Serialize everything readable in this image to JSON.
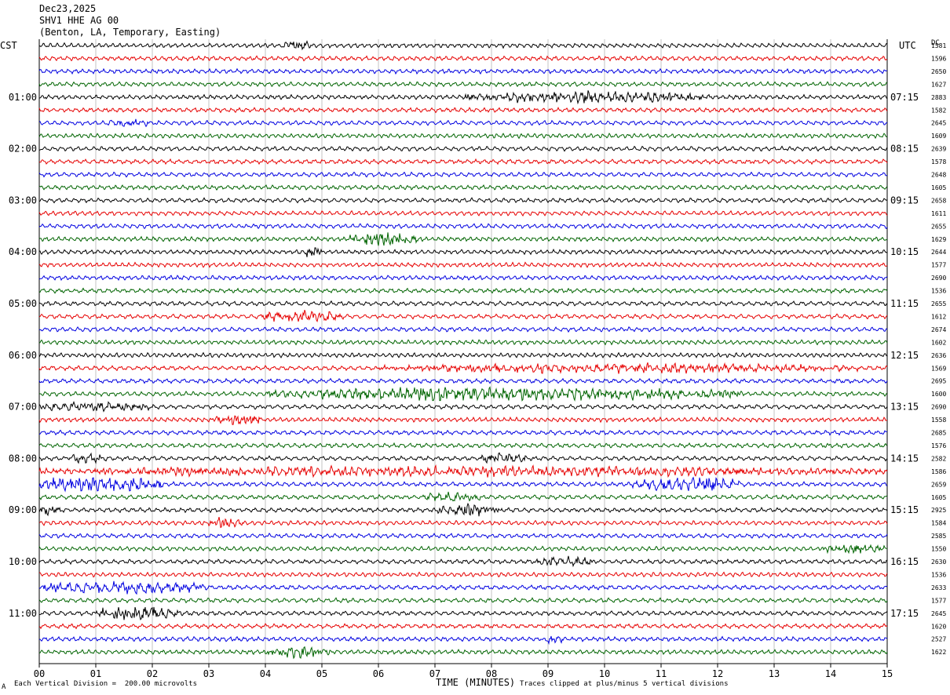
{
  "header": {
    "date": "Dec23,2025",
    "station": "SHV1 HHE AG 00",
    "location": "(Benton, LA, Temporary, Easting)"
  },
  "axes": {
    "left_label": "CST",
    "right_label": "UTC",
    "dc_label": "DC",
    "x_label": "TIME (MINUTES)",
    "footer_left": "Each Vertical Division =  200.00 microvolts",
    "footer_right": "Traces clipped at plus/minus 5 vertical divisions",
    "corner_mark": "A"
  },
  "colors": {
    "trace_cycle": [
      "#000000",
      "#e60000",
      "#0000e0",
      "#006400"
    ],
    "grid": "#b4b4b4",
    "background": "#ffffff"
  },
  "chart_data": {
    "type": "line",
    "title": "",
    "xlabel": "TIME (MINUTES)",
    "x_ticks": [
      "00",
      "01",
      "02",
      "03",
      "04",
      "05",
      "06",
      "07",
      "08",
      "09",
      "10",
      "11",
      "12",
      "13",
      "14",
      "15"
    ],
    "xlim": [
      0,
      15
    ],
    "trace_count": 48,
    "left_hour_labels": [
      {
        "trace": 4,
        "label": "01:00"
      },
      {
        "trace": 8,
        "label": "02:00"
      },
      {
        "trace": 12,
        "label": "03:00"
      },
      {
        "trace": 16,
        "label": "04:00"
      },
      {
        "trace": 20,
        "label": "05:00"
      },
      {
        "trace": 24,
        "label": "06:00"
      },
      {
        "trace": 28,
        "label": "07:00"
      },
      {
        "trace": 32,
        "label": "08:00"
      },
      {
        "trace": 36,
        "label": "09:00"
      },
      {
        "trace": 40,
        "label": "10:00"
      },
      {
        "trace": 44,
        "label": "11:00"
      }
    ],
    "right_hour_labels": [
      {
        "trace": 4,
        "label": "07:15"
      },
      {
        "trace": 8,
        "label": "08:15"
      },
      {
        "trace": 12,
        "label": "09:15"
      },
      {
        "trace": 16,
        "label": "10:15"
      },
      {
        "trace": 20,
        "label": "11:15"
      },
      {
        "trace": 24,
        "label": "12:15"
      },
      {
        "trace": 28,
        "label": "13:15"
      },
      {
        "trace": 32,
        "label": "14:15"
      },
      {
        "trace": 36,
        "label": "15:15"
      },
      {
        "trace": 40,
        "label": "16:15"
      },
      {
        "trace": 44,
        "label": "17:15"
      }
    ],
    "dc_offsets": [
      "1581",
      "1596",
      "2650",
      "1627",
      "2883",
      "1582",
      "2645",
      "1609",
      "2639",
      "1578",
      "2648",
      "1605",
      "2658",
      "1611",
      "2655",
      "1629",
      "2644",
      "1577",
      "2690",
      "1536",
      "2655",
      "1612",
      "2674",
      "1602",
      "2636",
      "1569",
      "2695",
      "1600",
      "2690",
      "1558",
      "2685",
      "1576",
      "2582",
      "1586",
      "2659",
      "1605",
      "2925",
      "1584",
      "2585",
      "1550",
      "2630",
      "1536",
      "2633",
      "1577",
      "2645",
      "1620",
      "2527",
      "1622"
    ],
    "bursts": [
      {
        "trace": 0,
        "start": 4.3,
        "end": 4.8,
        "amp": 1.8
      },
      {
        "trace": 4,
        "start": 7.5,
        "end": 11.9,
        "amp": 1.9
      },
      {
        "trace": 6,
        "start": 1.2,
        "end": 2.0,
        "amp": 1.5
      },
      {
        "trace": 15,
        "start": 5.5,
        "end": 6.7,
        "amp": 2.4
      },
      {
        "trace": 16,
        "start": 4.6,
        "end": 5.0,
        "amp": 2.0
      },
      {
        "trace": 21,
        "start": 3.9,
        "end": 5.4,
        "amp": 2.0
      },
      {
        "trace": 25,
        "start": 6.0,
        "end": 14.5,
        "amp": 1.6
      },
      {
        "trace": 27,
        "start": 4.0,
        "end": 12.5,
        "amp": 2.2
      },
      {
        "trace": 27,
        "start": 6.5,
        "end": 7.6,
        "amp": 3.2
      },
      {
        "trace": 28,
        "start": 0.0,
        "end": 2.0,
        "amp": 1.6
      },
      {
        "trace": 29,
        "start": 3.1,
        "end": 4.0,
        "amp": 2.0
      },
      {
        "trace": 32,
        "start": 0.5,
        "end": 1.2,
        "amp": 1.7
      },
      {
        "trace": 32,
        "start": 7.8,
        "end": 8.6,
        "amp": 1.8
      },
      {
        "trace": 33,
        "start": 0.0,
        "end": 15.0,
        "amp": 1.7
      },
      {
        "trace": 34,
        "start": 0.0,
        "end": 2.2,
        "amp": 2.8
      },
      {
        "trace": 34,
        "start": 10.5,
        "end": 12.5,
        "amp": 2.4
      },
      {
        "trace": 35,
        "start": 6.8,
        "end": 7.8,
        "amp": 1.8
      },
      {
        "trace": 36,
        "start": 0.0,
        "end": 0.4,
        "amp": 2.0
      },
      {
        "trace": 36,
        "start": 7.0,
        "end": 8.2,
        "amp": 2.0
      },
      {
        "trace": 37,
        "start": 3.0,
        "end": 3.6,
        "amp": 1.8
      },
      {
        "trace": 39,
        "start": 13.8,
        "end": 15.0,
        "amp": 1.7
      },
      {
        "trace": 40,
        "start": 8.8,
        "end": 9.8,
        "amp": 1.8
      },
      {
        "trace": 42,
        "start": 0.0,
        "end": 3.0,
        "amp": 2.0
      },
      {
        "trace": 44,
        "start": 1.0,
        "end": 2.5,
        "amp": 2.4
      },
      {
        "trace": 46,
        "start": 8.9,
        "end": 9.3,
        "amp": 1.8
      },
      {
        "trace": 47,
        "start": 4.0,
        "end": 5.2,
        "amp": 1.8
      }
    ]
  }
}
